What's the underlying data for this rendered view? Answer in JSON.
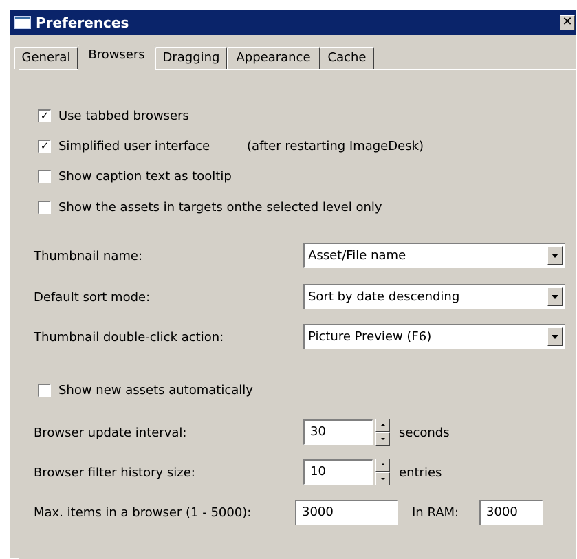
{
  "window": {
    "title": "Preferences",
    "close_glyph": "✕"
  },
  "tabs": [
    {
      "label": "General",
      "active": false
    },
    {
      "label": "Browsers",
      "active": true
    },
    {
      "label": "Dragging",
      "active": false
    },
    {
      "label": "Appearance",
      "active": false
    },
    {
      "label": "Cache",
      "active": false
    }
  ],
  "options": {
    "use_tabbed_browsers": {
      "label": "Use tabbed browsers",
      "checked": true
    },
    "simplified_ui": {
      "label": "Simplified user interface",
      "checked": true,
      "note": "(after restarting ImageDesk)"
    },
    "caption_tooltip": {
      "label": "Show caption text as tooltip",
      "checked": false
    },
    "assets_selected_level": {
      "label": "Show the assets in targets onthe selected level only",
      "checked": false
    },
    "show_new_assets": {
      "label": "Show new assets automatically",
      "checked": false
    }
  },
  "fields": {
    "thumbnail_name": {
      "label": "Thumbnail name:",
      "value": "Asset/File name"
    },
    "default_sort": {
      "label": "Default sort mode:",
      "value": "Sort by date descending"
    },
    "double_click": {
      "label": "Thumbnail double-click action:",
      "value": "Picture Preview (F6)"
    },
    "update_interval": {
      "label": "Browser update interval:",
      "value": "30",
      "unit": "seconds"
    },
    "filter_history": {
      "label": "Browser filter history size:",
      "value": "10",
      "unit": "entries"
    },
    "max_items": {
      "label": "Max. items in a browser (1 - 5000):",
      "value": "3000",
      "ram_label": "In RAM:",
      "ram_value": "3000"
    }
  },
  "check_glyph": "✓"
}
